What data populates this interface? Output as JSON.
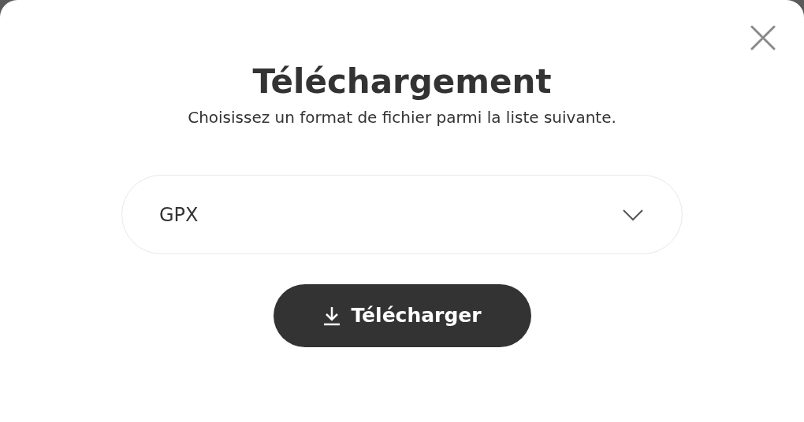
{
  "dialog": {
    "title": "Téléchargement",
    "subtitle": "Choisissez un format de fichier parmi la liste suivante.",
    "format_select": {
      "value": "GPX"
    },
    "download_button": {
      "label": "Télécharger"
    }
  }
}
